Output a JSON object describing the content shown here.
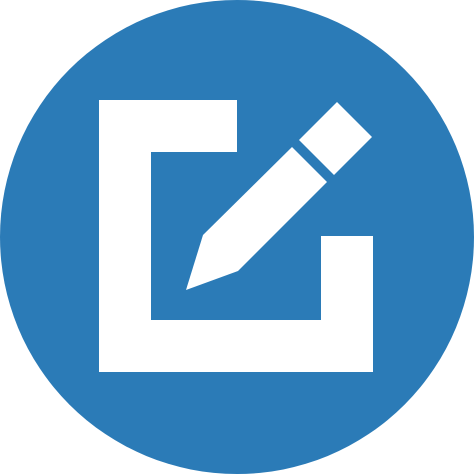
{
  "icon": {
    "name": "edit-icon",
    "description_free": true,
    "colors": {
      "background": "#ffffff",
      "badge": "#2b7bb7",
      "glyph": "#ffffff"
    },
    "parts": [
      "circle-badge",
      "frame-icon",
      "pencil-icon"
    ]
  }
}
